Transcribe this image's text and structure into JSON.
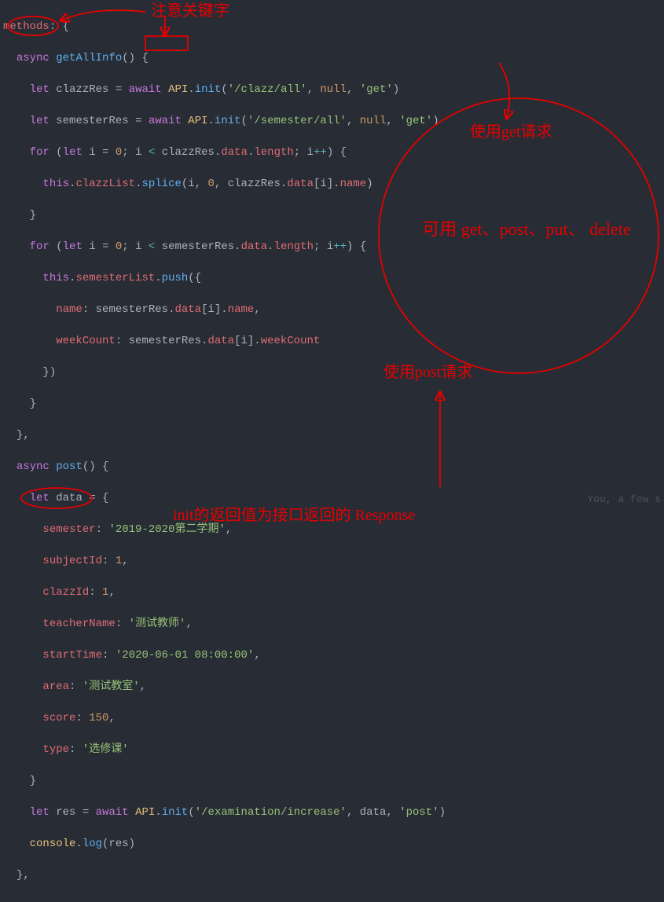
{
  "code": {
    "l1": {
      "methods": "methods",
      "colon": ": {"
    },
    "l2": {
      "async": "async",
      "fn": "getAllInfo",
      "rest": "() {"
    },
    "l3": {
      "let": "let",
      "v": "clazzRes",
      "eq": " = ",
      "await": "await",
      "api": "API",
      "init": "init",
      "s1": "'/clazz/all'",
      "null": "null",
      "s2": "'get'"
    },
    "l4": {
      "let": "let",
      "v": "semesterRes",
      "eq": " = ",
      "await": "await",
      "api": "API",
      "init": "init",
      "s1": "'/semester/all'",
      "null": "null",
      "s2": "'get'"
    },
    "l5": {
      "for": "for",
      "let": "let",
      "i": "i",
      "z": "0",
      "lt": "<",
      "v": "clazzRes",
      "data": "data",
      "len": "length",
      "inc": "++"
    },
    "l6": {
      "this": "this",
      "clazzList": "clazzList",
      "splice": "splice",
      "i": "i",
      "z": "0",
      "v": "clazzRes",
      "data": "data",
      "name": "name"
    },
    "l7": {
      "brace": "}"
    },
    "l8": {
      "for": "for",
      "let": "let",
      "i": "i",
      "z": "0",
      "lt": "<",
      "v": "semesterRes",
      "data": "data",
      "len": "length",
      "inc": "++"
    },
    "l9": {
      "this": "this",
      "list": "semesterList",
      "push": "push"
    },
    "l10": {
      "name": "name",
      "v": "semesterRes",
      "data": "data",
      "i": "i",
      "prop": "name"
    },
    "l11": {
      "wc": "weekCount",
      "v": "semesterRes",
      "data": "data",
      "i": "i",
      "prop": "weekCount"
    },
    "l12": {
      "b": "})"
    },
    "l13": {
      "b": "}"
    },
    "l14": {
      "b": "},"
    },
    "l15": {
      "async": "async",
      "fn": "post",
      "rest": "() {"
    },
    "l16": {
      "let": "let",
      "v": "data",
      "eq": " = {"
    },
    "l17": {
      "k": "semester",
      "v": "'2019-2020第二学期'"
    },
    "l18": {
      "k": "subjectId",
      "v": "1"
    },
    "l19": {
      "k": "clazzId",
      "v": "1"
    },
    "l20": {
      "k": "teacherName",
      "v": "'测试教师'"
    },
    "l21": {
      "k": "startTime",
      "v": "'2020-06-01 08:00:00'"
    },
    "l22": {
      "k": "area",
      "v": "'测试教室'"
    },
    "l23": {
      "k": "score",
      "v": "150"
    },
    "l24": {
      "k": "type",
      "v": "'选修课'"
    },
    "l25": {
      "b": "}"
    },
    "l26": {
      "let": "let",
      "v": "res",
      "eq": " = ",
      "await": "await",
      "api": "API",
      "init": "init",
      "s1": "'/examination/increase'",
      "d": "data",
      "s2": "'post'"
    },
    "l27": {
      "console": "console",
      "log": "log",
      "v": "res"
    },
    "l28": {
      "b": "},"
    }
  },
  "annotations": {
    "note_keyword": "注意关键字",
    "use_get": "使用get请求",
    "methods_list": "可用 get、post、put、 delete",
    "use_post": "使用post请求",
    "init_return": "init的返回值为接口返回的 Response"
  },
  "git_blame": "You, a few s"
}
